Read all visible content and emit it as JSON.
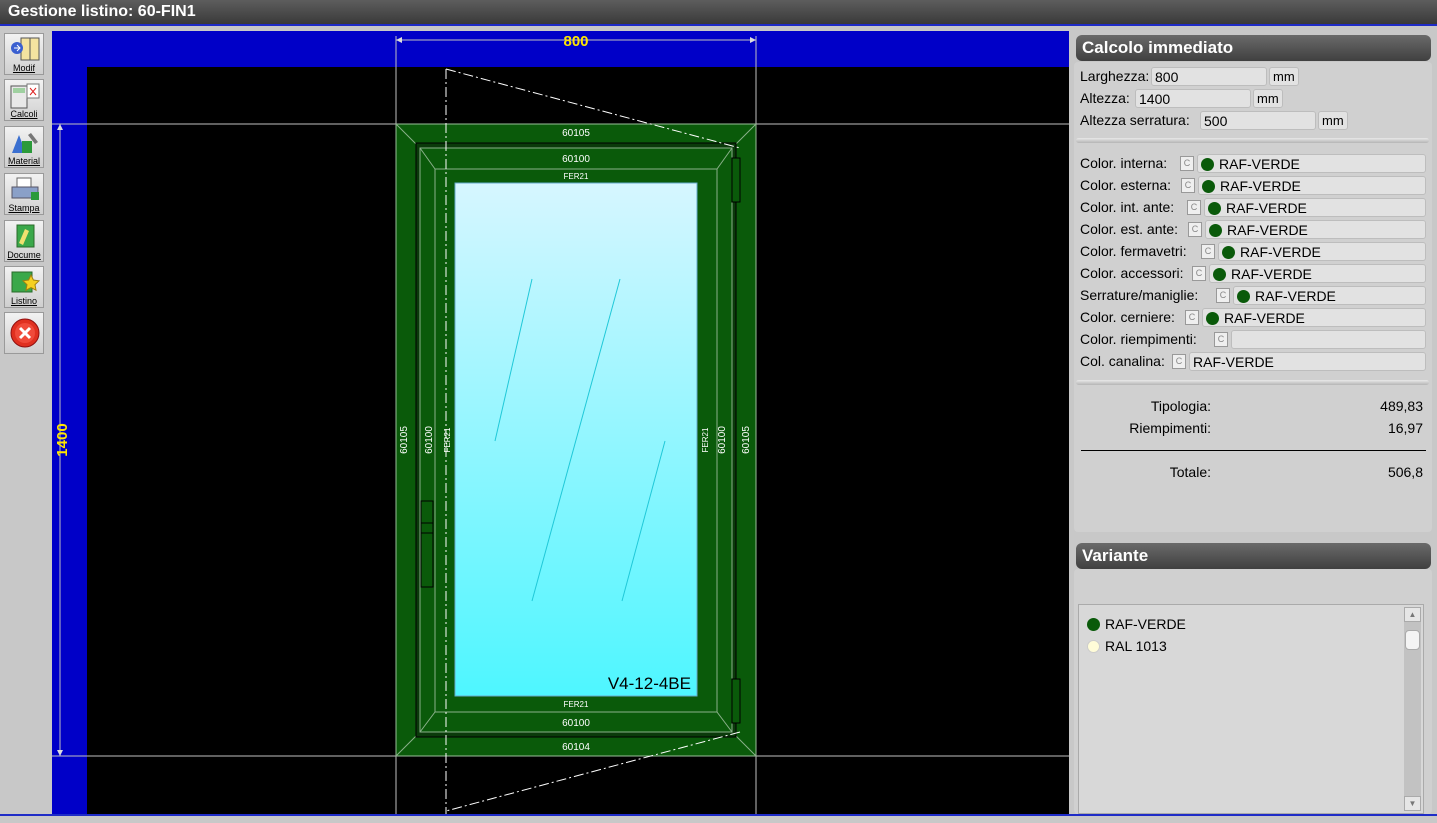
{
  "window": {
    "title": "Gestione listino: 60-FIN1"
  },
  "toolbar": [
    {
      "label": "Modif",
      "icon": "edit-window-icon"
    },
    {
      "label": "Calcoli",
      "icon": "calculator-icon"
    },
    {
      "label": "Material",
      "icon": "materials-icon"
    },
    {
      "label": "Stampa",
      "icon": "printer-icon"
    },
    {
      "label": "Docume",
      "icon": "document-icon"
    },
    {
      "label": "Listino",
      "icon": "star-list-icon"
    },
    {
      "label": "",
      "icon": "close-icon"
    }
  ],
  "drawing": {
    "width_dim": "800",
    "height_dim": "1400",
    "profiles": {
      "top_outer": "60105",
      "top_sash": "60100",
      "top_bead": "FER21",
      "bottom_bead": "FER21",
      "bottom_sash": "60100",
      "bottom_outer": "60104",
      "left_outer": "60105",
      "left_sash": "60100",
      "left_bead": "FER21",
      "right_bead": "FER21",
      "right_sash": "60100",
      "right_outer": "60105"
    },
    "glass": "V4-12-4BE",
    "colors": {
      "background": "#000000",
      "frame": "#0a5a0a",
      "canvas_border": "#0000c8",
      "glass_top": "#d6f6ff",
      "glass_bottom": "#4ef6ff"
    }
  },
  "calcolo": {
    "title": "Calcolo immediato",
    "larghezza": {
      "label": "Larghezza:",
      "value": "800",
      "unit": "mm"
    },
    "altezza": {
      "label": "Altezza:",
      "value": "1400",
      "unit": "mm"
    },
    "altezza_serratura": {
      "label": "Altezza serratura:",
      "value": "500",
      "unit": "mm"
    },
    "colors": [
      {
        "label": "Color. interna:",
        "value": "RAF-VERDE",
        "dot": "#0a5a0a"
      },
      {
        "label": "Color. esterna:",
        "value": "RAF-VERDE",
        "dot": "#0a5a0a"
      },
      {
        "label": "Color. int. ante:",
        "value": "RAF-VERDE",
        "dot": "#0a5a0a"
      },
      {
        "label": "Color. est. ante:",
        "value": "RAF-VERDE",
        "dot": "#0a5a0a"
      },
      {
        "label": "Color. fermavetri:",
        "value": "RAF-VERDE",
        "dot": "#0a5a0a"
      },
      {
        "label": "Color. accessori:",
        "value": "RAF-VERDE",
        "dot": "#0a5a0a"
      },
      {
        "label": "Serrature/maniglie:",
        "value": "RAF-VERDE",
        "dot": "#0a5a0a"
      },
      {
        "label": "Color. cerniere:",
        "value": "RAF-VERDE",
        "dot": "#0a5a0a"
      },
      {
        "label": "Color. riempimenti:",
        "value": "",
        "dot": ""
      },
      {
        "label": "Col. canalina:",
        "value": "RAF-VERDE",
        "dot": ""
      }
    ],
    "c_button": "C",
    "tipologia": {
      "label": "Tipologia:",
      "value": "489,83"
    },
    "riempimenti": {
      "label": "Riempimenti:",
      "value": "16,97"
    },
    "totale": {
      "label": "Totale:",
      "value": "506,8"
    }
  },
  "variante": {
    "title": "Variante",
    "items": [
      {
        "label": "RAF-VERDE",
        "dot": "#0a5a0a"
      },
      {
        "label": "RAL 1013",
        "dot": "#fffcd8"
      }
    ]
  }
}
